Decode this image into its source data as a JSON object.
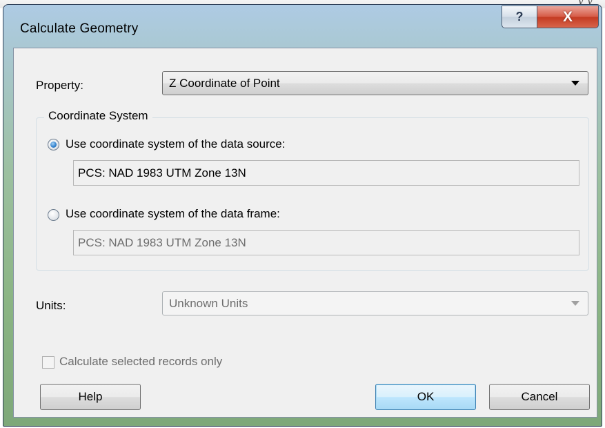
{
  "window": {
    "title": "Calculate Geometry",
    "help_glyph": "?",
    "close_glyph": "X"
  },
  "background_text": "y    y",
  "property": {
    "label": "Property:",
    "value": "Z Coordinate of Point"
  },
  "coordinate_system": {
    "legend": "Coordinate System",
    "source_option": {
      "label": "Use coordinate system of the data source:",
      "checked": true,
      "value": "PCS: NAD 1983 UTM Zone 13N"
    },
    "frame_option": {
      "label": "Use coordinate system of the data frame:",
      "checked": false,
      "value": "PCS: NAD 1983 UTM Zone 13N"
    }
  },
  "units": {
    "label": "Units:",
    "value": "Unknown Units",
    "enabled": false
  },
  "selected_only": {
    "label": "Calculate selected records only",
    "checked": false,
    "enabled": false
  },
  "buttons": {
    "help": "Help",
    "ok": "OK",
    "cancel": "Cancel"
  },
  "colors": {
    "close_button": "#c33a22",
    "default_button_border": "#3c7fb1",
    "radio_dot": "#2f7fcc"
  }
}
